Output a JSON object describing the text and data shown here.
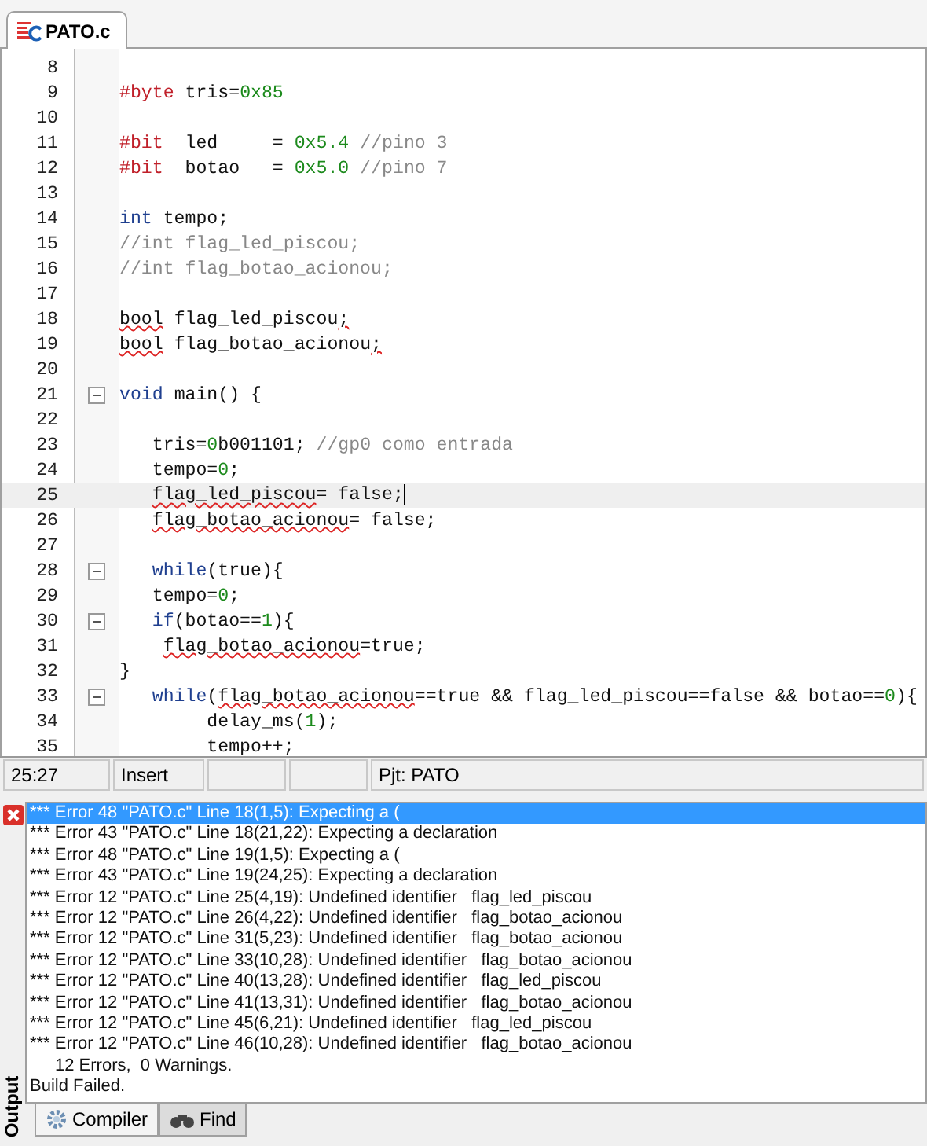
{
  "tabs": [
    {
      "label": "PATO.c",
      "selected": true
    }
  ],
  "code_lines": [
    {
      "number": "8",
      "fold": false,
      "current": false
    },
    {
      "number": "9",
      "fold": false,
      "current": false,
      "tokens": [
        {
          "t": "#byte",
          "kind": "pp"
        },
        {
          "t": " tris=",
          "kind": "txt"
        },
        {
          "t": "0x85",
          "kind": "num"
        }
      ]
    },
    {
      "number": "10",
      "fold": false,
      "current": false
    },
    {
      "number": "11",
      "fold": false,
      "current": false,
      "tokens": [
        {
          "t": "#bit",
          "kind": "pp"
        },
        {
          "t": "  led     = ",
          "kind": "txt"
        },
        {
          "t": "0x5.4",
          "kind": "num"
        },
        {
          "t": " //pino 3",
          "kind": "cm"
        }
      ]
    },
    {
      "number": "12",
      "fold": false,
      "current": false,
      "tokens": [
        {
          "t": "#bit",
          "kind": "pp"
        },
        {
          "t": "  botao   = ",
          "kind": "txt"
        },
        {
          "t": "0x5.0",
          "kind": "num"
        },
        {
          "t": " //pino 7",
          "kind": "cm"
        }
      ]
    },
    {
      "number": "13",
      "fold": false,
      "current": false
    },
    {
      "number": "14",
      "fold": false,
      "current": false,
      "tokens": [
        {
          "t": "int",
          "kind": "kw"
        },
        {
          "t": " tempo;",
          "kind": "txt"
        }
      ]
    },
    {
      "number": "15",
      "fold": false,
      "current": false,
      "tokens": [
        {
          "t": "//int flag_led_piscou;",
          "kind": "cm"
        }
      ]
    },
    {
      "number": "16",
      "fold": false,
      "current": false,
      "tokens": [
        {
          "t": "//int flag_botao_acionou;",
          "kind": "cm"
        }
      ]
    },
    {
      "number": "17",
      "fold": false,
      "current": false
    },
    {
      "number": "18",
      "fold": false,
      "current": false,
      "tokens": [
        {
          "t": "bool",
          "kind": "txt",
          "squiggle": true
        },
        {
          "t": " flag_led_piscou",
          "kind": "txt",
          "squiggle": false
        },
        {
          "t": ";",
          "kind": "txt",
          "squiggle": true
        }
      ]
    },
    {
      "number": "19",
      "fold": false,
      "current": false,
      "tokens": [
        {
          "t": "bool",
          "kind": "txt",
          "squiggle": true
        },
        {
          "t": " flag_botao_acionou",
          "kind": "txt",
          "squiggle": false
        },
        {
          "t": ";",
          "kind": "txt",
          "squiggle": true
        }
      ]
    },
    {
      "number": "20",
      "fold": false,
      "current": false
    },
    {
      "number": "21",
      "fold": true,
      "current": false,
      "tokens": [
        {
          "t": "void",
          "kind": "kw"
        },
        {
          "t": " main() {",
          "kind": "txt"
        }
      ]
    },
    {
      "number": "22",
      "fold": false,
      "current": false
    },
    {
      "number": "23",
      "fold": false,
      "current": false,
      "tokens": [
        {
          "t": "   tris=",
          "kind": "txt"
        },
        {
          "t": "0",
          "kind": "num"
        },
        {
          "t": "b001101; ",
          "kind": "txt"
        },
        {
          "t": "//gp0 como entrada",
          "kind": "cm"
        }
      ]
    },
    {
      "number": "24",
      "fold": false,
      "current": false,
      "tokens": [
        {
          "t": "   tempo=",
          "kind": "txt"
        },
        {
          "t": "0",
          "kind": "num"
        },
        {
          "t": ";",
          "kind": "txt"
        }
      ]
    },
    {
      "number": "25",
      "fold": false,
      "current": true,
      "tokens": [
        {
          "t": "   flag_led_piscou",
          "kind": "txt",
          "squiggle": true
        },
        {
          "t": "= false;",
          "kind": "txt",
          "squiggle": false
        }
      ]
    },
    {
      "number": "26",
      "fold": false,
      "current": false,
      "tokens": [
        {
          "t": "   flag_botao_acionou",
          "kind": "txt",
          "squiggle": true
        },
        {
          "t": "= false;",
          "kind": "txt",
          "squiggle": false
        }
      ]
    },
    {
      "number": "27",
      "fold": false,
      "current": false
    },
    {
      "number": "28",
      "fold": true,
      "current": false,
      "tokens": [
        {
          "t": "   while",
          "kind": "kw"
        },
        {
          "t": "(true){",
          "kind": "txt"
        }
      ]
    },
    {
      "number": "29",
      "fold": false,
      "current": false,
      "tokens": [
        {
          "t": "   tempo=",
          "kind": "txt"
        },
        {
          "t": "0",
          "kind": "num"
        },
        {
          "t": ";",
          "kind": "txt"
        }
      ]
    },
    {
      "number": "30",
      "fold": true,
      "current": false,
      "tokens": [
        {
          "t": "   if",
          "kind": "kw"
        },
        {
          "t": "(botao==",
          "kind": "txt"
        },
        {
          "t": "1",
          "kind": "num"
        },
        {
          "t": "){",
          "kind": "txt"
        }
      ]
    },
    {
      "number": "31",
      "fold": false,
      "current": false,
      "tokens": [
        {
          "t": "    flag_botao_acionou",
          "kind": "txt",
          "squiggle": true
        },
        {
          "t": "=true;",
          "kind": "txt",
          "squiggle": false
        }
      ]
    },
    {
      "number": "32",
      "fold": false,
      "current": false,
      "tokens": [
        {
          "t": "}",
          "kind": "txt"
        }
      ]
    },
    {
      "number": "33",
      "fold": true,
      "current": false,
      "tokens": [
        {
          "t": "   while",
          "kind": "kw"
        },
        {
          "t": "(",
          "kind": "txt"
        },
        {
          "t": "flag_botao_acionou",
          "kind": "txt",
          "squiggle": true
        },
        {
          "t": "==true && flag_led_piscou==false && botao==",
          "kind": "txt",
          "squiggle": false
        },
        {
          "t": "0",
          "kind": "num"
        },
        {
          "t": "){",
          "kind": "txt"
        }
      ]
    },
    {
      "number": "34",
      "fold": false,
      "current": false,
      "tokens": [
        {
          "t": "        delay_ms(",
          "kind": "txt"
        },
        {
          "t": "1",
          "kind": "num"
        },
        {
          "t": ");",
          "kind": "txt"
        }
      ]
    },
    {
      "number": "35",
      "fold": false,
      "current": false,
      "tokens": [
        {
          "t": "        tempo++;",
          "kind": "txt"
        }
      ]
    }
  ],
  "status_bar": {
    "position": "25:27",
    "mode": "Insert",
    "project": "Pjt: PATO"
  },
  "output": {
    "title": "Output",
    "messages": [
      {
        "text": "*** Error 48 \"PATO.c\" Line 18(1,5): Expecting a (",
        "selected": true
      },
      {
        "text": "*** Error 43 \"PATO.c\" Line 18(21,22): Expecting a declaration",
        "selected": false
      },
      {
        "text": "*** Error 48 \"PATO.c\" Line 19(1,5): Expecting a (",
        "selected": false
      },
      {
        "text": "*** Error 43 \"PATO.c\" Line 19(24,25): Expecting a declaration",
        "selected": false
      },
      {
        "text": "*** Error 12 \"PATO.c\" Line 25(4,19): Undefined identifier   flag_led_piscou",
        "selected": false
      },
      {
        "text": "*** Error 12 \"PATO.c\" Line 26(4,22): Undefined identifier   flag_botao_acionou",
        "selected": false
      },
      {
        "text": "*** Error 12 \"PATO.c\" Line 31(5,23): Undefined identifier   flag_botao_acionou",
        "selected": false
      },
      {
        "text": "*** Error 12 \"PATO.c\" Line 33(10,28): Undefined identifier   flag_botao_acionou",
        "selected": false
      },
      {
        "text": "*** Error 12 \"PATO.c\" Line 40(13,28): Undefined identifier   flag_led_piscou",
        "selected": false
      },
      {
        "text": "*** Error 12 \"PATO.c\" Line 41(13,31): Undefined identifier   flag_botao_acionou",
        "selected": false
      },
      {
        "text": "*** Error 12 \"PATO.c\" Line 45(6,21): Undefined identifier   flag_led_piscou",
        "selected": false
      },
      {
        "text": "*** Error 12 \"PATO.c\" Line 46(10,28): Undefined identifier   flag_botao_acionou",
        "selected": false
      }
    ],
    "summary": "12 Errors,  0 Warnings.",
    "result": "Build Failed.",
    "tabs": [
      {
        "label": "Compiler",
        "selected": true
      },
      {
        "label": "Find",
        "selected": false
      }
    ]
  }
}
